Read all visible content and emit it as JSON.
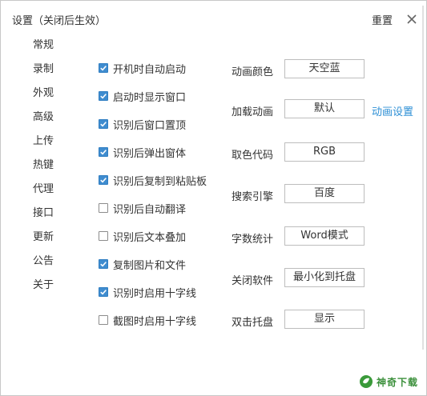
{
  "window": {
    "title": "设置（关闭后生效）",
    "reset_label": "重置",
    "close_icon": "close-icon"
  },
  "sidebar": {
    "items": [
      {
        "label": "常规",
        "active": true
      },
      {
        "label": "录制"
      },
      {
        "label": "外观"
      },
      {
        "label": "高级"
      },
      {
        "label": "上传"
      },
      {
        "label": "热键"
      },
      {
        "label": "代理"
      },
      {
        "label": "接口"
      },
      {
        "label": "更新"
      },
      {
        "label": "公告"
      },
      {
        "label": "关于"
      }
    ]
  },
  "general": {
    "checkboxes": [
      {
        "label": "开机时自动启动",
        "checked": true
      },
      {
        "label": "启动时显示窗口",
        "checked": true
      },
      {
        "label": "识别后窗口置顶",
        "checked": true
      },
      {
        "label": "识别后弹出窗体",
        "checked": true
      },
      {
        "label": "识别后复制到粘贴板",
        "checked": true
      },
      {
        "label": "识别后自动翻译",
        "checked": false
      },
      {
        "label": "识别后文本叠加",
        "checked": false
      },
      {
        "label": "复制图片和文件",
        "checked": true
      },
      {
        "label": "识别时启用十字线",
        "checked": true
      },
      {
        "label": "截图时启用十字线",
        "checked": false
      }
    ],
    "options": [
      {
        "label": "动画颜色",
        "value": "天空蓝"
      },
      {
        "label": "加载动画",
        "value": "默认"
      },
      {
        "label": "取色代码",
        "value": "RGB"
      },
      {
        "label": "搜索引擎",
        "value": "百度"
      },
      {
        "label": "字数统计",
        "value": "Word模式"
      },
      {
        "label": "关闭软件",
        "value": "最小化到托盘"
      },
      {
        "label": "双击托盘",
        "value": "显示"
      }
    ],
    "animation_settings_link": "动画设置"
  },
  "watermark": {
    "text": "神奇下载"
  },
  "colors": {
    "checkbox_checked": "#3f8ccf",
    "link": "#2d8fd5",
    "watermark": "#3a8f3a"
  }
}
